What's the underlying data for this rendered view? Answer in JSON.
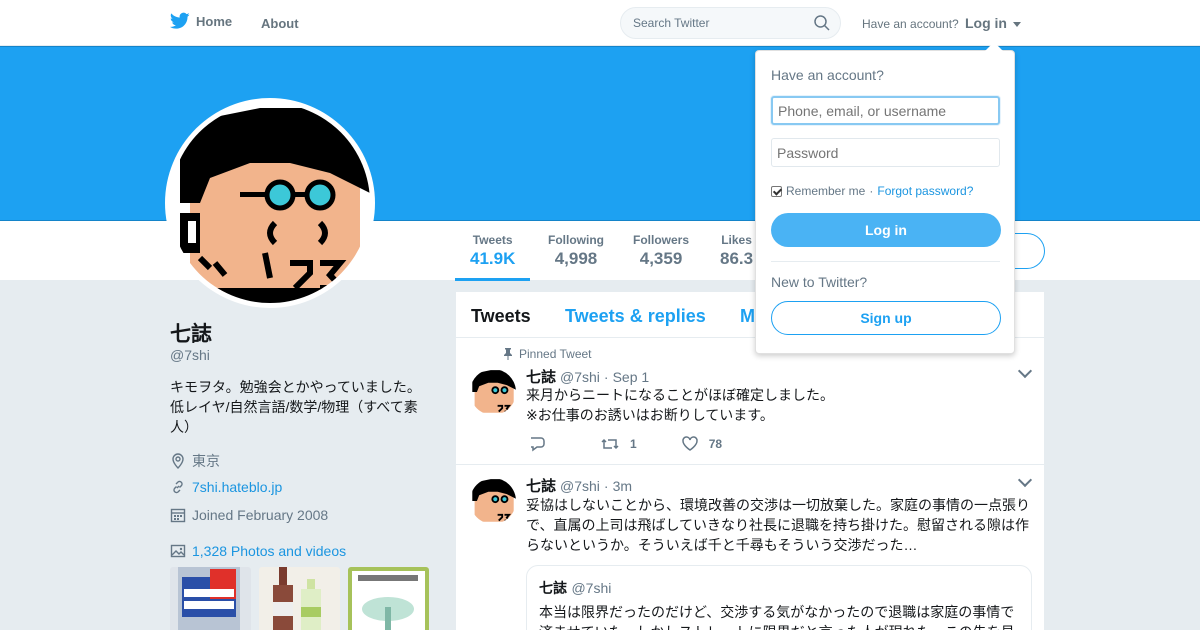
{
  "nav": {
    "home_label": "Home",
    "about_label": "About",
    "search_placeholder": "Search Twitter",
    "have_account": "Have an account?",
    "login_label": "Log in"
  },
  "profile_nav": {
    "stats": [
      {
        "label": "Tweets",
        "value": "41.9K",
        "active": true
      },
      {
        "label": "Following",
        "value": "4,998"
      },
      {
        "label": "Followers",
        "value": "4,359"
      },
      {
        "label": "Likes",
        "value": "86.3"
      }
    ]
  },
  "profile": {
    "name": "七誌",
    "handle": "@7shi",
    "bio": "キモヲタ。勉強会とかやっていました。低レイヤ/自然言語/数学/物理（すべて素人）",
    "location": "東京",
    "website": "7shi.hateblo.jp",
    "joined": "Joined February 2008",
    "photos_label": "1,328 Photos and videos"
  },
  "timeline": {
    "tabs": [
      "Tweets",
      "Tweets & replies",
      "M"
    ],
    "tweets": [
      {
        "pinned_label": "Pinned Tweet",
        "name": "七誌",
        "handle": "@7shi",
        "time": "Sep 1",
        "text": "来月からニートになることがほぼ確定しました。\n※お仕事のお誘いはお断りしています。",
        "retweets": "1",
        "likes": "78"
      },
      {
        "name": "七誌",
        "handle": "@7shi",
        "time": "3m",
        "text": "妥協はしないことから、環境改善の交渉は一切放棄した。家庭の事情の一点張りで、直属の上司は飛ばしていきなり社長に退職を持ち掛けた。慰留される隙は作らないというか。そういえば千と千尋もそういう交渉だった…",
        "quote": {
          "name": "七誌",
          "handle": "@7shi",
          "text": "本当は限界だったのだけど、交渉する気がなかったので退職は家庭の事情で済ませていた。しかしストレートに限界だと言った人が現れた。この先を見"
        }
      }
    ]
  },
  "login_dropdown": {
    "title": "Have an account?",
    "username_placeholder": "Phone, email, or username",
    "password_placeholder": "Password",
    "remember_label": "Remember me",
    "separator": "·",
    "forgot_label": "Forgot password?",
    "login_button": "Log in",
    "new_to": "New to Twitter?",
    "signup_button": "Sign up"
  },
  "colors": {
    "brand": "#1da1f2",
    "text": "#14171a",
    "muted": "#657786",
    "link": "#1b95e0"
  }
}
